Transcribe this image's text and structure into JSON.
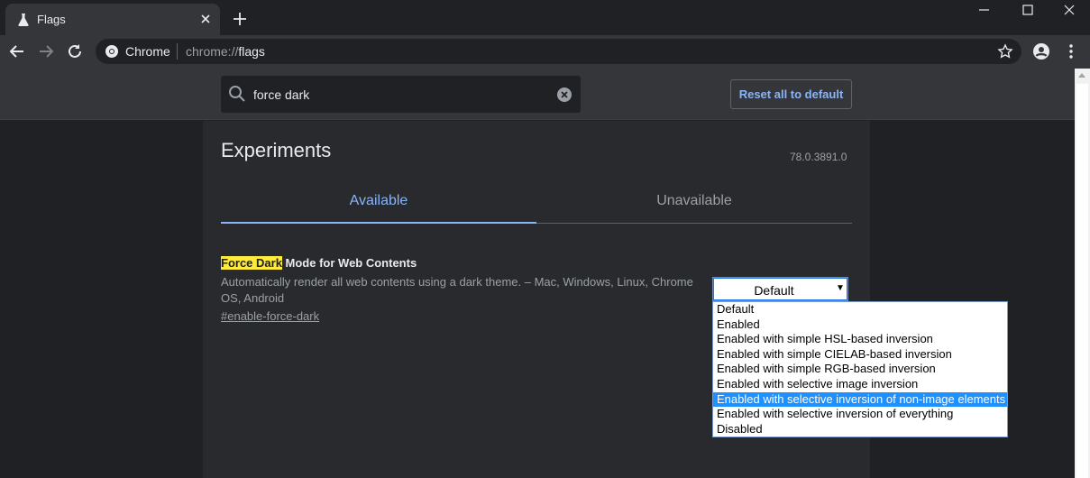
{
  "browser": {
    "tab_title": "Flags",
    "omnibox_chip": "Chrome",
    "url_scheme": "chrome://",
    "url_path": "flags"
  },
  "header": {
    "search_value": "force dark",
    "reset_label": "Reset all to default"
  },
  "experiments": {
    "title": "Experiments",
    "version": "78.0.3891.0",
    "tabs": [
      {
        "label": "Available",
        "active": true
      },
      {
        "label": "Unavailable",
        "active": false
      }
    ]
  },
  "flag": {
    "highlight": "Force Dark",
    "title_rest": " Mode for Web Contents",
    "description": "Automatically render all web contents using a dark theme. – Mac, Windows, Linux, Chrome OS, Android",
    "link": "#enable-force-dark",
    "selected_value": "Default",
    "options": [
      "Default",
      "Enabled",
      "Enabled with simple HSL-based inversion",
      "Enabled with simple CIELAB-based inversion",
      "Enabled with simple RGB-based inversion",
      "Enabled with selective image inversion",
      "Enabled with selective inversion of non-image elements",
      "Enabled with selective inversion of everything",
      "Disabled"
    ],
    "highlighted_option": "Enabled with selective inversion of non-image elements"
  },
  "colors": {
    "background": "#202124",
    "accent": "#8ab4f8",
    "highlight": "#ffeb3b",
    "selected_option": "#1e90ff"
  },
  "icons": [
    "flask-icon",
    "close-icon",
    "plus-icon",
    "minimize-icon",
    "maximize-icon",
    "window-close-icon",
    "back-arrow-icon",
    "forward-arrow-icon",
    "reload-icon",
    "chrome-logo-icon",
    "star-icon",
    "account-icon",
    "kebab-menu-icon",
    "search-icon",
    "clear-icon"
  ]
}
